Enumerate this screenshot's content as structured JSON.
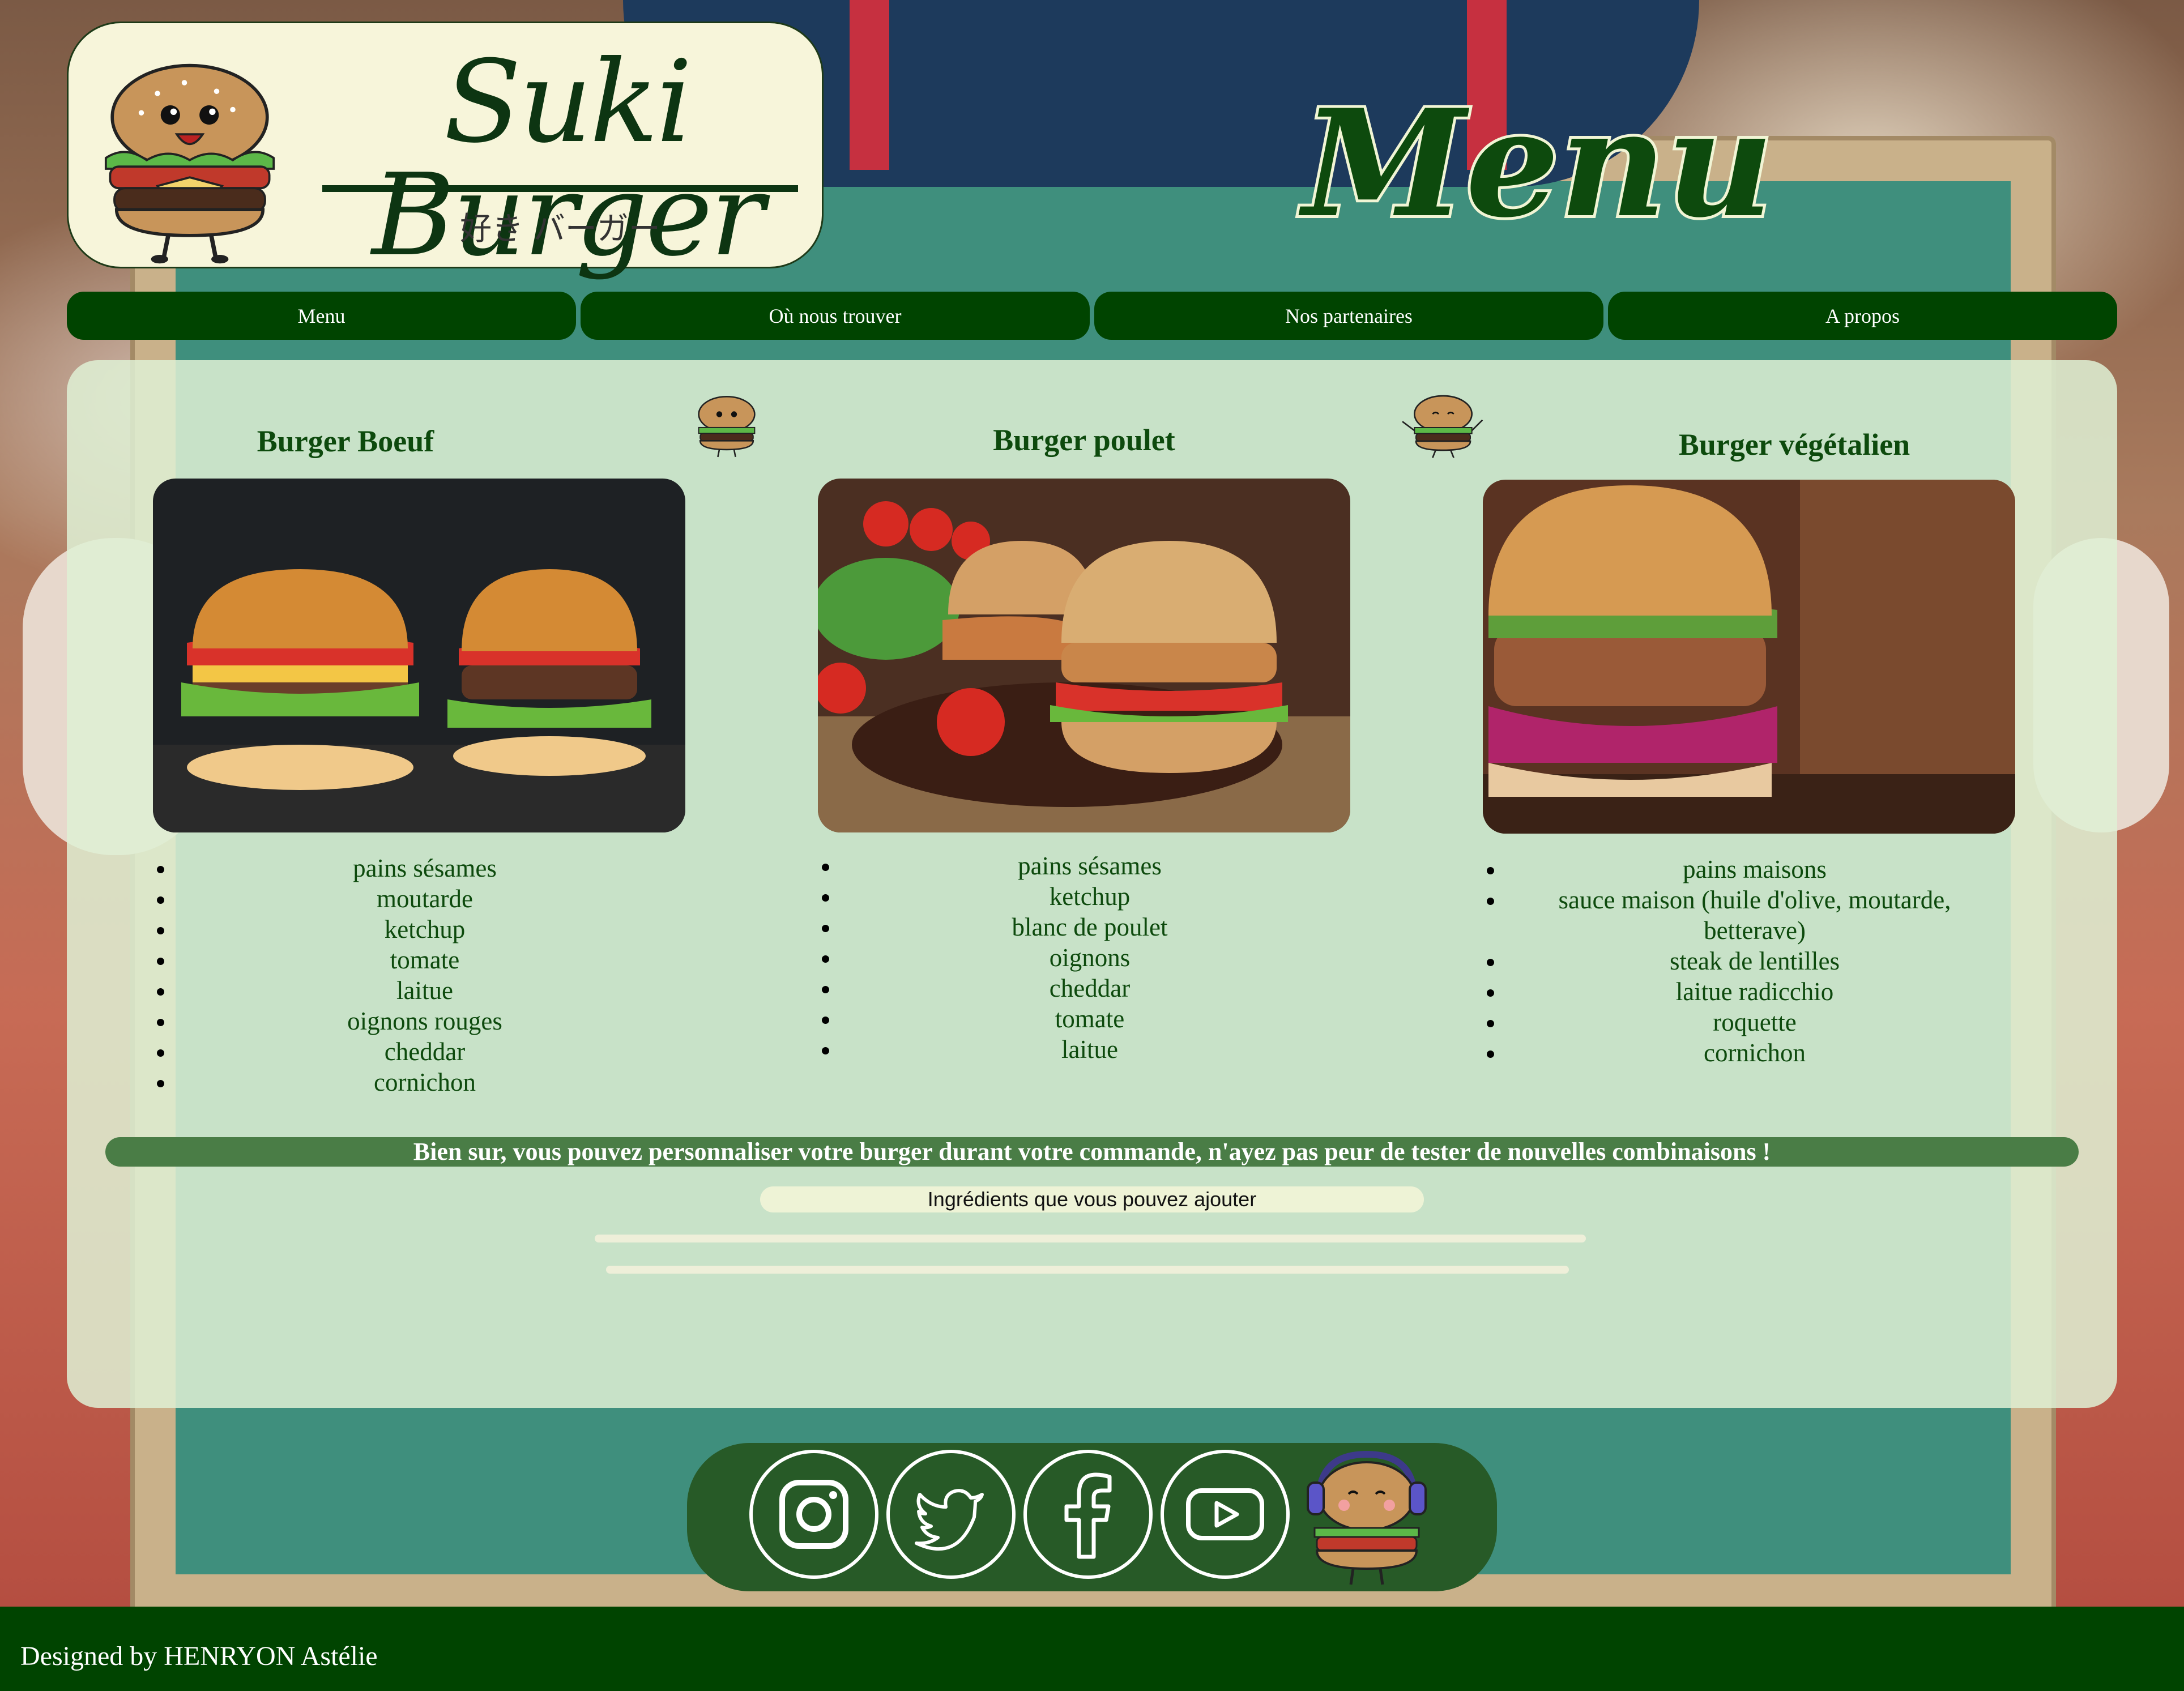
{
  "brand": {
    "title": "Suki Burger",
    "subtitle": "好き バーガー"
  },
  "page_title": "Menu",
  "nav": {
    "items": [
      {
        "label": "Menu"
      },
      {
        "label": "Où nous trouver"
      },
      {
        "label": "Nos partenaires"
      },
      {
        "label": "A propos"
      }
    ]
  },
  "burgers": [
    {
      "name": "Burger Boeuf",
      "image": "beef-burger-photo",
      "ingredients": [
        "pains sésames",
        "moutarde",
        "ketchup",
        "tomate",
        "laitue",
        "oignons rouges",
        "cheddar",
        "cornichon"
      ]
    },
    {
      "name": "Burger poulet",
      "image": "chicken-burger-photo",
      "ingredients": [
        "pains sésames",
        "ketchup",
        "blanc de poulet",
        "oignons",
        "cheddar",
        "tomate",
        "laitue"
      ]
    },
    {
      "name": "Burger végétalien",
      "image": "vegan-burger-photo",
      "ingredients": [
        "pains maisons",
        "sauce maison (huile d'olive, moutarde, betterave)",
        "steak de lentilles",
        "laitue radicchio",
        "roquette",
        "cornichon"
      ]
    }
  ],
  "promo_text": "Bien sur, vous pouvez personnaliser votre burger durant votre commande, n'ayez pas peur de tester de nouvelles combinaisons !",
  "ingredients_button": "Ingrédients que vous pouvez ajouter",
  "social": {
    "icons": [
      "instagram-icon",
      "twitter-icon",
      "facebook-icon",
      "youtube-icon"
    ]
  },
  "footer": {
    "credit": "Designed by HENRYON Astélie"
  },
  "colors": {
    "primary_green": "#004400",
    "panel_bg": "#def0d4",
    "promo_green": "#4a7d46",
    "logo_bg": "#f7f5da"
  }
}
